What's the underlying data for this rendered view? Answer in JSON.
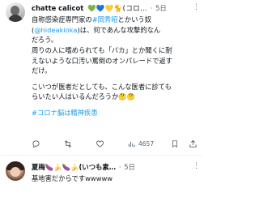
{
  "tweet1": {
    "name": "chatte calicot",
    "name_emojis": "💚💙💛🐈(コロ…",
    "time": "5日",
    "lines": [
      [
        "自称感染症専門家の",
        "#岡秀昭",
        "とかいう奴"
      ],
      [
        "(",
        "@hideakioka",
        ")は、何であんな攻撃的なん"
      ],
      [
        "だろう。"
      ],
      [
        "周りの人に嗜められても「バカ」とか聞くに耐"
      ],
      [
        "えないような口汚い罵倒のオンパレードで返す"
      ],
      [
        "だけ。"
      ],
      [
        "こいつが医者だとしても、こんな医者に診ても"
      ],
      [
        "らいたい人はいるんだろうか🤔🤔"
      ],
      [
        "#コロナ脳は精神疾患"
      ]
    ],
    "views": "4657"
  },
  "tweet2": {
    "name": "夏梅🍆🍌🍆🍌(いつも素…",
    "time": "5日",
    "text": "基地害だからですwwwww"
  },
  "colors": {
    "link": "#1d9bf0",
    "muted": "#536471"
  },
  "icons": [
    "reply-icon",
    "retweet-icon",
    "like-icon",
    "views-icon",
    "bookmark-icon",
    "share-icon",
    "more-icon"
  ]
}
